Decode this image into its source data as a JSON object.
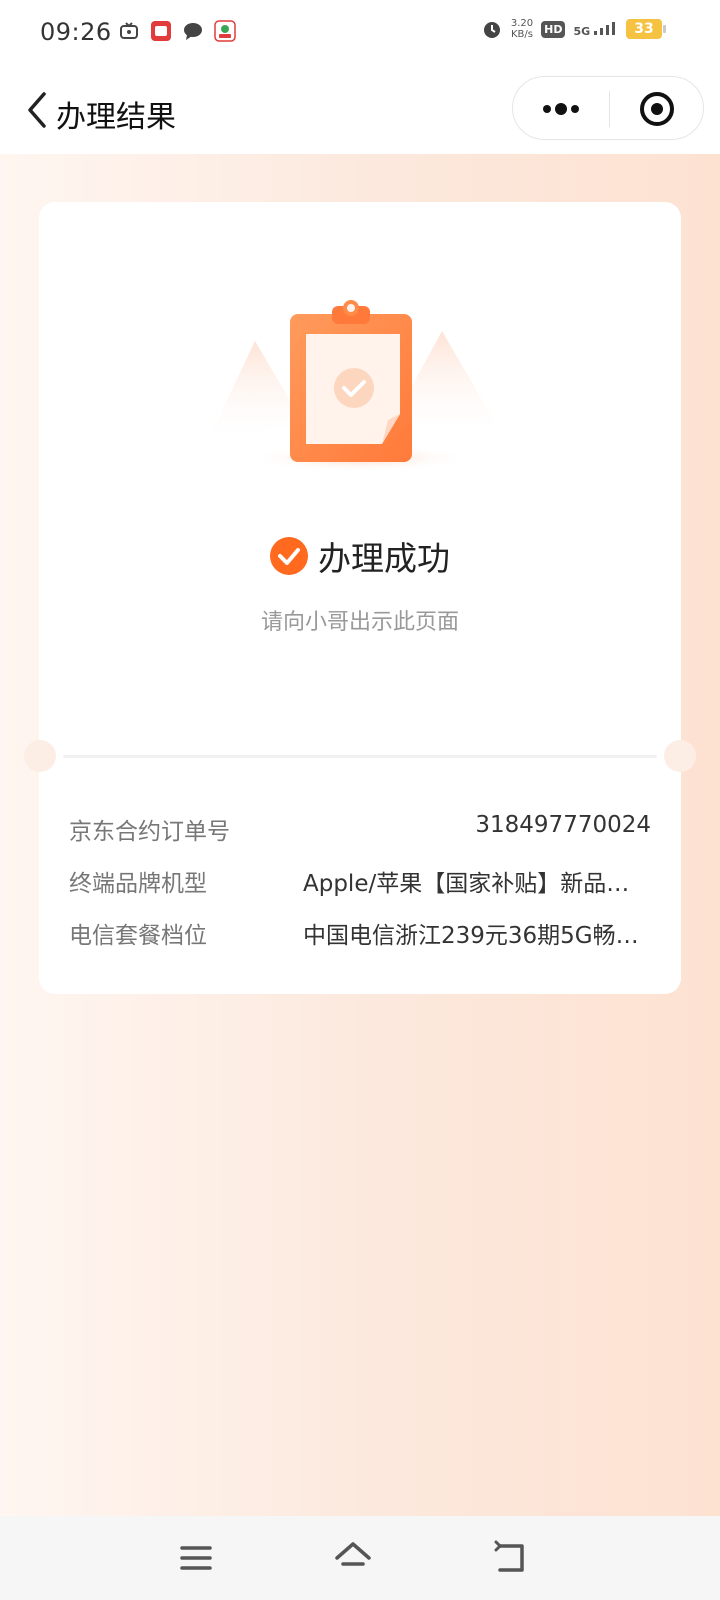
{
  "status_bar": {
    "time": "09:26",
    "net_speed_value": "3.20",
    "net_speed_unit": "KB/s",
    "hd": "HD",
    "network": "5G",
    "battery": "33"
  },
  "nav": {
    "title": "办理结果",
    "icons": [
      "chevron-left-icon",
      "more-dots-icon",
      "target-close-icon"
    ]
  },
  "result": {
    "status": "办理成功",
    "hint": "请向小哥出示此页面"
  },
  "details": [
    {
      "label": "京东合约订单号",
      "value": "318497770024"
    },
    {
      "label": "终端品牌机型",
      "value": "Apple/苹果【国家补贴】新品…"
    },
    {
      "label": "电信套餐档位",
      "value": "中国电信浙江239元36期5G畅…"
    }
  ],
  "colors": {
    "accent": "#ff6a1f",
    "background_gradient_start": "#fff6f1",
    "background_gradient_end": "#fde2d2"
  },
  "system_nav": {
    "icons": [
      "menu-icon",
      "home-icon",
      "back-icon"
    ]
  }
}
